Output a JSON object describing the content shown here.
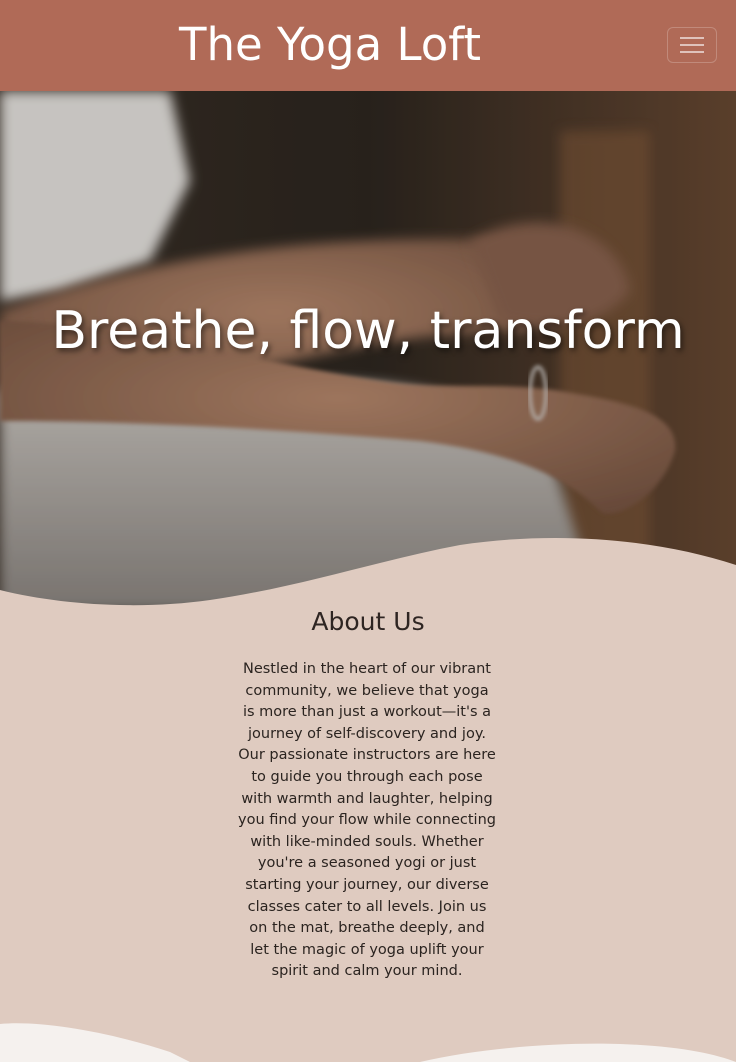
{
  "navbar": {
    "brand": "The Yoga Loft",
    "toggler_icon": "hamburger-icon"
  },
  "hero": {
    "title": "Breathe, flow, transform"
  },
  "about": {
    "title": "About Us",
    "body": "Nestled in the heart of our vibrant community, we believe that yoga is more than just a workout—it's a journey of self-discovery and joy. Our passionate instructors are here to guide you through each pose with warmth and laughter, helping you find your flow while connecting with like-minded souls. Whether you're a seasoned yogi or just starting your journey, our diverse classes cater to all levels. Join us on the mat, breathe deeply, and let the magic of yoga uplift your spirit and calm your mind."
  },
  "colors": {
    "navbar": "#b06a57",
    "section_bg": "#dfcbc0",
    "footer_wave": "#f5f1ee"
  }
}
